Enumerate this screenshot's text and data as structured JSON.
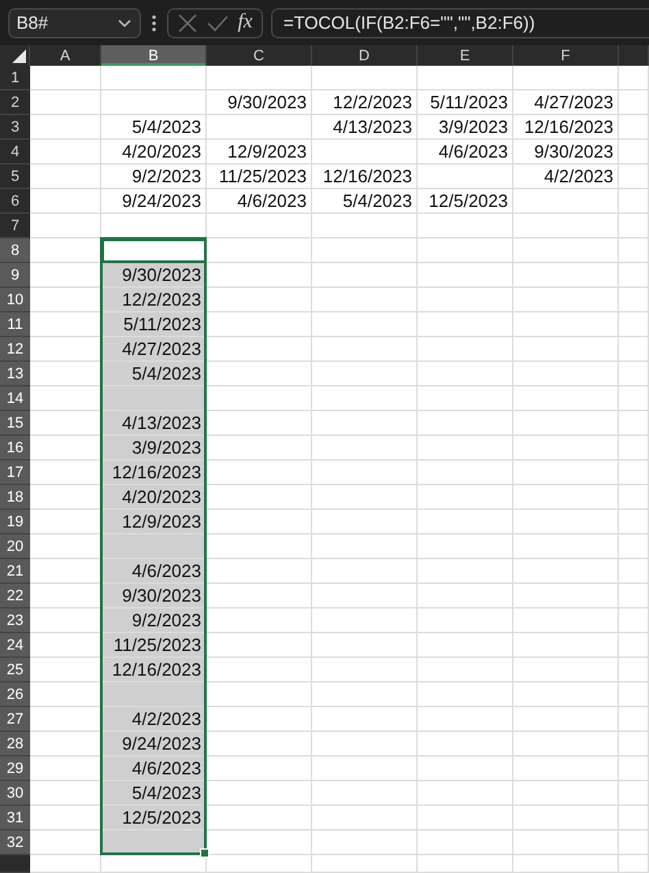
{
  "formula_bar": {
    "name_box": "B8#",
    "function_label": "fx",
    "formula": "=TOCOL(IF(B2:F6=\"\",\"\",B2:F6))"
  },
  "columns": [
    {
      "label": "A",
      "selected": false
    },
    {
      "label": "B",
      "selected": true
    },
    {
      "label": "C",
      "selected": false
    },
    {
      "label": "D",
      "selected": false
    },
    {
      "label": "E",
      "selected": false
    },
    {
      "label": "F",
      "selected": false
    }
  ],
  "rows": [
    {
      "number": "1",
      "selected": false,
      "active": false,
      "cells": [
        null,
        null,
        null,
        null,
        null,
        null
      ]
    },
    {
      "number": "2",
      "selected": false,
      "active": false,
      "cells": [
        null,
        null,
        "9/30/2023",
        "12/2/2023",
        "5/11/2023",
        "4/27/2023"
      ]
    },
    {
      "number": "3",
      "selected": false,
      "active": false,
      "cells": [
        null,
        "5/4/2023",
        null,
        "4/13/2023",
        "3/9/2023",
        "12/16/2023"
      ]
    },
    {
      "number": "4",
      "selected": false,
      "active": false,
      "cells": [
        null,
        "4/20/2023",
        "12/9/2023",
        null,
        "4/6/2023",
        "9/30/2023"
      ]
    },
    {
      "number": "5",
      "selected": false,
      "active": false,
      "cells": [
        null,
        "9/2/2023",
        "11/25/2023",
        "12/16/2023",
        null,
        "4/2/2023"
      ]
    },
    {
      "number": "6",
      "selected": false,
      "active": false,
      "cells": [
        null,
        "9/24/2023",
        "4/6/2023",
        "5/4/2023",
        "12/5/2023",
        null
      ]
    },
    {
      "number": "7",
      "selected": false,
      "active": false,
      "cells": [
        null,
        null,
        null,
        null,
        null,
        null
      ]
    },
    {
      "number": "8",
      "selected": true,
      "active": true,
      "cells": [
        null,
        null,
        null,
        null,
        null,
        null
      ]
    },
    {
      "number": "9",
      "selected": true,
      "active": false,
      "cells": [
        null,
        "9/30/2023",
        null,
        null,
        null,
        null
      ]
    },
    {
      "number": "10",
      "selected": true,
      "active": false,
      "cells": [
        null,
        "12/2/2023",
        null,
        null,
        null,
        null
      ]
    },
    {
      "number": "11",
      "selected": true,
      "active": false,
      "cells": [
        null,
        "5/11/2023",
        null,
        null,
        null,
        null
      ]
    },
    {
      "number": "12",
      "selected": true,
      "active": false,
      "cells": [
        null,
        "4/27/2023",
        null,
        null,
        null,
        null
      ]
    },
    {
      "number": "13",
      "selected": true,
      "active": false,
      "cells": [
        null,
        "5/4/2023",
        null,
        null,
        null,
        null
      ]
    },
    {
      "number": "14",
      "selected": true,
      "active": false,
      "cells": [
        null,
        null,
        null,
        null,
        null,
        null
      ]
    },
    {
      "number": "15",
      "selected": true,
      "active": false,
      "cells": [
        null,
        "4/13/2023",
        null,
        null,
        null,
        null
      ]
    },
    {
      "number": "16",
      "selected": true,
      "active": false,
      "cells": [
        null,
        "3/9/2023",
        null,
        null,
        null,
        null
      ]
    },
    {
      "number": "17",
      "selected": true,
      "active": false,
      "cells": [
        null,
        "12/16/2023",
        null,
        null,
        null,
        null
      ]
    },
    {
      "number": "18",
      "selected": true,
      "active": false,
      "cells": [
        null,
        "4/20/2023",
        null,
        null,
        null,
        null
      ]
    },
    {
      "number": "19",
      "selected": true,
      "active": false,
      "cells": [
        null,
        "12/9/2023",
        null,
        null,
        null,
        null
      ]
    },
    {
      "number": "20",
      "selected": true,
      "active": false,
      "cells": [
        null,
        null,
        null,
        null,
        null,
        null
      ]
    },
    {
      "number": "21",
      "selected": true,
      "active": false,
      "cells": [
        null,
        "4/6/2023",
        null,
        null,
        null,
        null
      ]
    },
    {
      "number": "22",
      "selected": true,
      "active": false,
      "cells": [
        null,
        "9/30/2023",
        null,
        null,
        null,
        null
      ]
    },
    {
      "number": "23",
      "selected": true,
      "active": false,
      "cells": [
        null,
        "9/2/2023",
        null,
        null,
        null,
        null
      ]
    },
    {
      "number": "24",
      "selected": true,
      "active": false,
      "cells": [
        null,
        "11/25/2023",
        null,
        null,
        null,
        null
      ]
    },
    {
      "number": "25",
      "selected": true,
      "active": false,
      "cells": [
        null,
        "12/16/2023",
        null,
        null,
        null,
        null
      ]
    },
    {
      "number": "26",
      "selected": true,
      "active": false,
      "cells": [
        null,
        null,
        null,
        null,
        null,
        null
      ]
    },
    {
      "number": "27",
      "selected": true,
      "active": false,
      "cells": [
        null,
        "4/2/2023",
        null,
        null,
        null,
        null
      ]
    },
    {
      "number": "28",
      "selected": true,
      "active": false,
      "cells": [
        null,
        "9/24/2023",
        null,
        null,
        null,
        null
      ]
    },
    {
      "number": "29",
      "selected": true,
      "active": false,
      "cells": [
        null,
        "4/6/2023",
        null,
        null,
        null,
        null
      ]
    },
    {
      "number": "30",
      "selected": true,
      "active": false,
      "cells": [
        null,
        "5/4/2023",
        null,
        null,
        null,
        null
      ]
    },
    {
      "number": "31",
      "selected": true,
      "active": false,
      "cells": [
        null,
        "12/5/2023",
        null,
        null,
        null,
        null
      ]
    },
    {
      "number": "32",
      "selected": true,
      "active": false,
      "cells": [
        null,
        null,
        null,
        null,
        null,
        null
      ]
    }
  ]
}
